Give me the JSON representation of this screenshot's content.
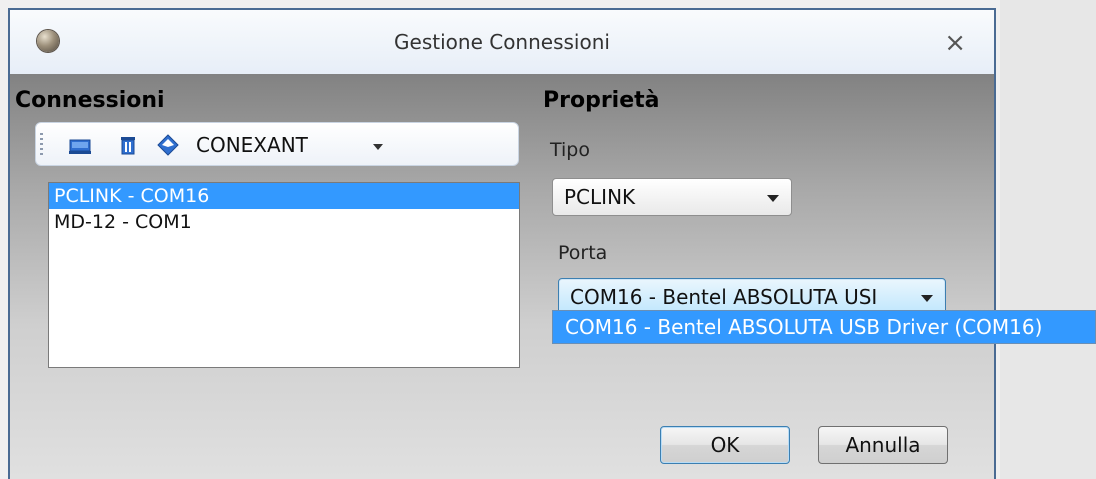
{
  "window": {
    "title": "Gestione Connessioni",
    "close_symbol": "×"
  },
  "connections": {
    "heading": "Connessioni",
    "toolbar": {
      "icons": [
        "monitor-icon",
        "trash-icon",
        "diamond-icon"
      ],
      "modem_value": "CONEXANT"
    },
    "items": [
      {
        "label": "PCLINK - COM16",
        "selected": true
      },
      {
        "label": "MD-12 - COM1",
        "selected": false
      }
    ]
  },
  "properties": {
    "heading": "Proprietà",
    "tipo_label": "Tipo",
    "tipo_value": "PCLINK",
    "porta_label": "Porta",
    "porta_value": "COM16 - Bentel ABSOLUTA USI",
    "porta_options": [
      "COM16 - Bentel ABSOLUTA USB Driver (COM16)"
    ]
  },
  "buttons": {
    "ok": "OK",
    "cancel": "Annulla"
  },
  "colors": {
    "selection": "#3399ff",
    "window_border": "#4a6b93"
  }
}
